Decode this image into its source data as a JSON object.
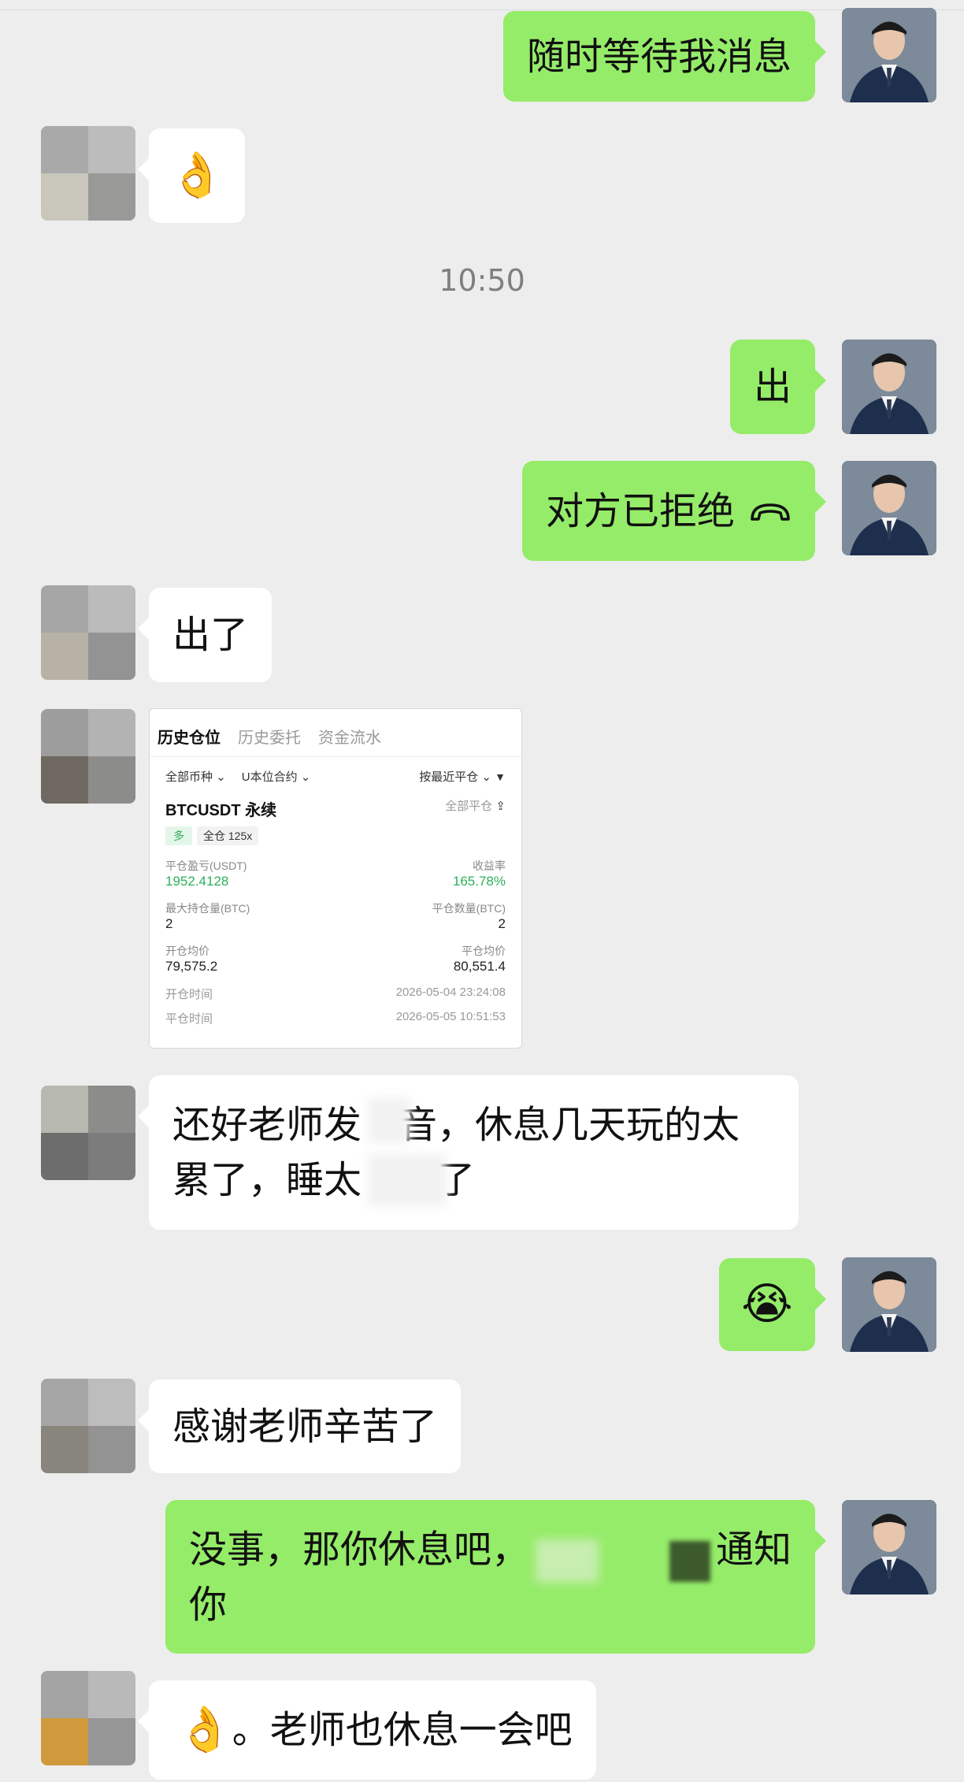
{
  "messages": {
    "m1": "随时等待我消息",
    "m2_emoji": "👌",
    "time": "10:50",
    "m3": "出",
    "m4": "对方已拒绝",
    "m4_icon": "phone-hangup-icon",
    "m5": "出了",
    "m7_line1": "还好老师发",
    "m7_line1b": "音，休息几天玩的太",
    "m7_line2": "累了，睡太",
    "m7_line2b": "了",
    "m8_emoji": "😭",
    "m9": "感谢老师辛苦了",
    "m10_line1": "没事，那你休息吧，",
    "m10_line1b": "通知",
    "m10_line2": "你",
    "m11_emoji": "👌",
    "m11": "。老师也休息一会吧"
  },
  "card": {
    "tabs": [
      "历史仓位",
      "历史委托",
      "资金流水"
    ],
    "filter_coin": "全部币种",
    "filter_type": "U本位合约",
    "filter_sort": "按最近平仓",
    "pair": "BTCUSDT 永续",
    "close_all": "全部平仓",
    "tag_side": "多",
    "tag_mode": "全仓 125x",
    "pnl_label": "平仓盈亏(USDT)",
    "pnl_value": "1952.4128",
    "roi_label": "收益率",
    "roi_value": "165.78%",
    "maxpos_label": "最大持仓量(BTC)",
    "maxpos_value": "2",
    "closeqty_label": "平仓数量(BTC)",
    "closeqty_value": "2",
    "open_avg_label": "开仓均价",
    "open_avg_value": "79,575.2",
    "close_avg_label": "平仓均价",
    "close_avg_value": "80,551.4",
    "open_time_label": "开仓时间",
    "open_time_value": "2026-05-04 23:24:08",
    "close_time_label": "平仓时间",
    "close_time_value": "2026-05-05 10:51:53"
  },
  "colors": {
    "bubble_me": "#95ec69",
    "bubble_other": "#ffffff",
    "background": "#ededed",
    "profit_green": "#2eaf5a"
  }
}
